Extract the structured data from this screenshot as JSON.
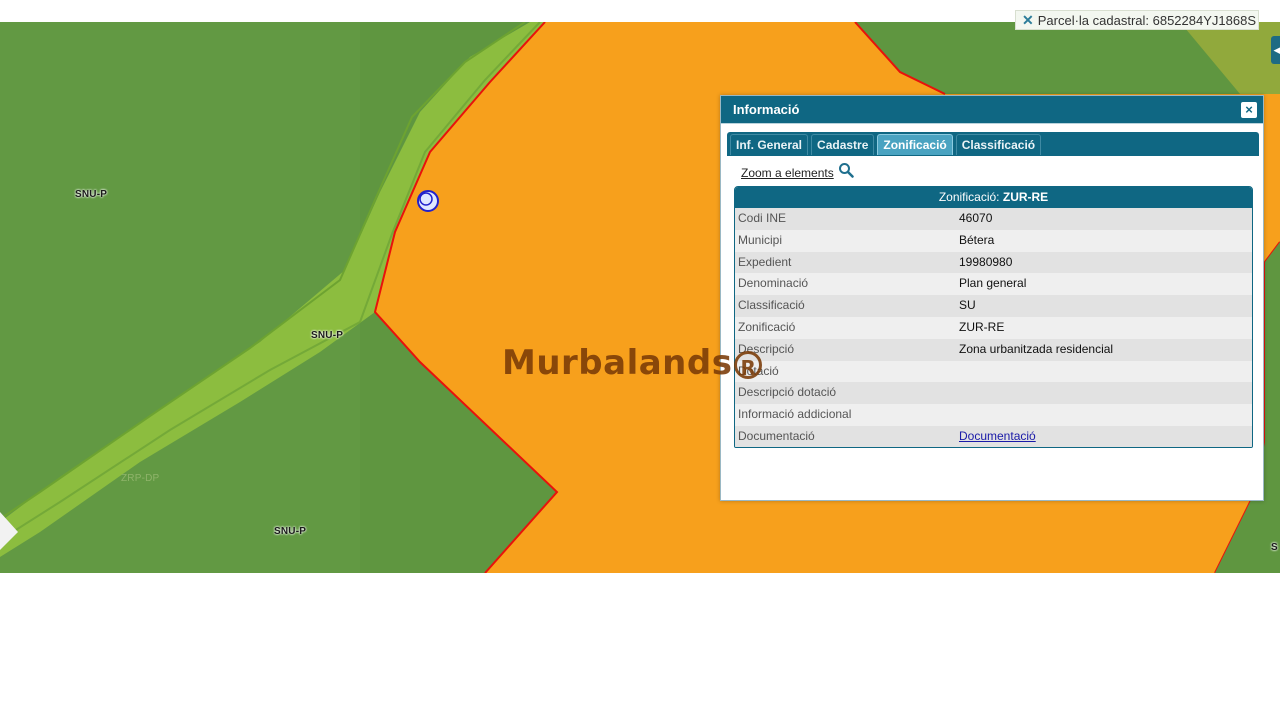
{
  "map": {
    "parcel_chip": "Parcel·la cadastral: 6852284YJ1868S",
    "labels": {
      "snu_p_1": "SNU-P",
      "snu_p_2": "SNU-P",
      "snu_p_3": "SNU-P",
      "zrp_dp": "ZRP-DP",
      "edge": "S"
    },
    "colors": {
      "urban_orange": "#f7a01c",
      "rural_green": "#5f9640",
      "corridor_green": "#8cbd3f",
      "boundary_red": "#e8120c"
    },
    "watermark": {
      "text": "Murbalands",
      "symbol": "R"
    }
  },
  "dialog": {
    "title": "Informació",
    "close": "×",
    "tabs": [
      "Inf. General",
      "Cadastre",
      "Zonificació",
      "Classificació"
    ],
    "active_tab": "Zonificació",
    "zoom_link": "Zoom a elements",
    "table": {
      "header_label": "Zonificació:",
      "header_value": "ZUR-RE",
      "rows": [
        {
          "key": "Codi INE",
          "value": "46070"
        },
        {
          "key": "Municipi",
          "value": "Bétera"
        },
        {
          "key": "Expedient",
          "value": "19980980"
        },
        {
          "key": "Denominació",
          "value": "Plan general"
        },
        {
          "key": "Classificació",
          "value": "SU"
        },
        {
          "key": "Zonificació",
          "value": "ZUR-RE"
        },
        {
          "key": "Descripció",
          "value": "Zona urbanitzada residencial"
        },
        {
          "key": "Dotació",
          "value": ""
        },
        {
          "key": "Descripció dotació",
          "value": ""
        },
        {
          "key": "Informació addicional",
          "value": ""
        },
        {
          "key": "Documentació",
          "value": "Documentació"
        }
      ]
    }
  }
}
